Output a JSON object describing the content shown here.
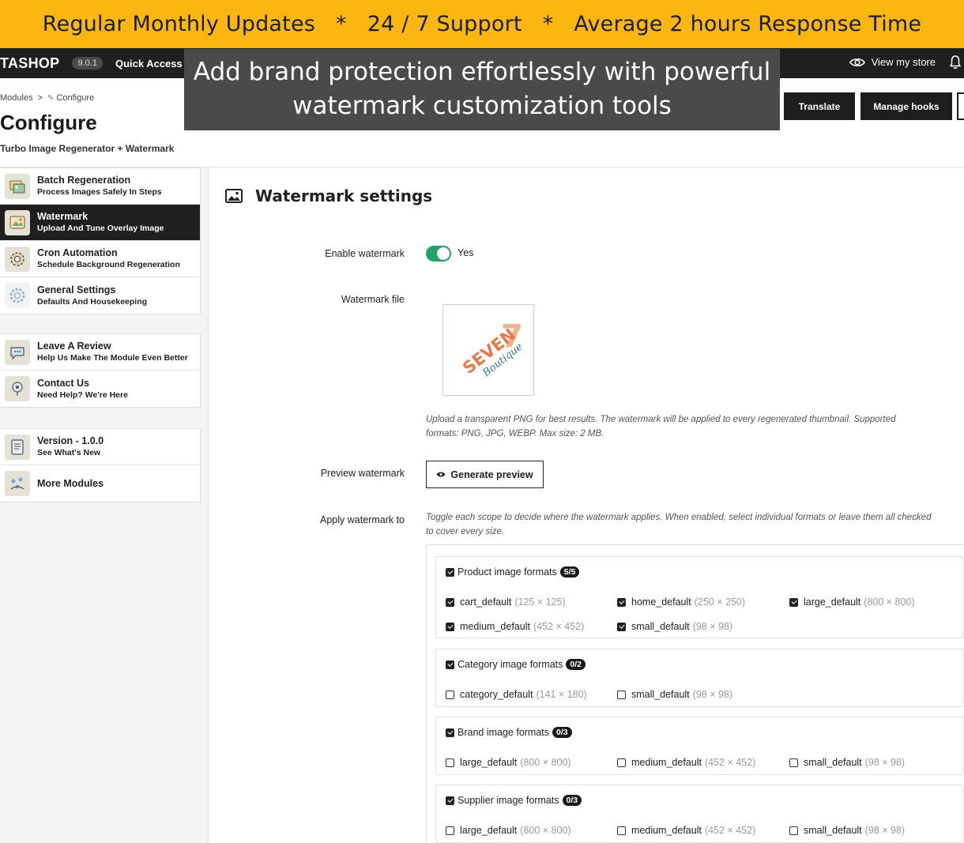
{
  "promo": {
    "items": [
      "Regular Monthly Updates",
      "24 / 7 Support",
      "Average 2 hours Response Time"
    ],
    "separator": "*"
  },
  "topnav": {
    "logo": "TASHOP",
    "version": "9.0.1",
    "quick_access": "Quick Access",
    "view_store": "View my store"
  },
  "overlay": {
    "line1": "Add brand protection effortlessly with powerful",
    "line2": "watermark customization tools"
  },
  "header": {
    "breadcrumb": [
      "Modules",
      "Configure"
    ],
    "breadcrumb_sep": ">",
    "title": "Configure",
    "subtitle": "Turbo Image Regenerator + Watermark",
    "translate": "Translate",
    "manage_hooks": "Manage hooks"
  },
  "sidebar": {
    "groups": [
      [
        {
          "title": "Batch Regeneration",
          "desc": "Process Images Safely In Steps",
          "icon": "images-icon",
          "active": false
        },
        {
          "title": "Watermark",
          "desc": "Upload And Tune Overlay Image",
          "icon": "watermark-icon",
          "active": true
        },
        {
          "title": "Cron Automation",
          "desc": "Schedule Background Regeneration",
          "icon": "cron-gear-icon",
          "active": false
        },
        {
          "title": "General Settings",
          "desc": "Defaults And Housekeeping",
          "icon": "settings-gear-icon",
          "active": false
        }
      ],
      [
        {
          "title": "Leave A Review",
          "desc": "Help Us Make The Module Even Better",
          "icon": "review-bubble-icon",
          "active": false
        },
        {
          "title": "Contact Us",
          "desc": "Need Help? We're Here",
          "icon": "contact-icon",
          "active": false
        }
      ],
      [
        {
          "title": "Version - 1.0.0",
          "desc": "See What's New",
          "icon": "changelog-icon",
          "active": false
        },
        {
          "title": "More Modules",
          "desc": "",
          "icon": "modules-icon",
          "active": false
        }
      ]
    ]
  },
  "main": {
    "section_title": "Watermark settings",
    "enable_label": "Enable watermark",
    "enable_value": "Yes",
    "file_label": "Watermark file",
    "logo_text_1": "SEVEN",
    "logo_text_2": "Boutique",
    "logo_number": "7",
    "file_help_1": "Upload a transparent PNG for best results. The watermark will be applied to every regenerated thumbnail. Supported",
    "file_help_2": "formats: PNG, JPG, WEBP. Max size: 2 MB.",
    "preview_label": "Preview watermark",
    "preview_button": "Generate preview",
    "apply_label": "Apply watermark to",
    "apply_help_1": "Toggle each scope to decide where the watermark applies. When enabled, select individual formats or leave them all checked",
    "apply_help_2": "to cover every size."
  },
  "scopes": [
    {
      "title": "Product image formats",
      "count": "5/5",
      "checked": true,
      "formats": [
        {
          "name": "cart_default",
          "dim": "(125 × 125)",
          "checked": true
        },
        {
          "name": "home_default",
          "dim": "(250 × 250)",
          "checked": true
        },
        {
          "name": "large_default",
          "dim": "(800 × 800)",
          "checked": true
        },
        {
          "name": "medium_default",
          "dim": "(452 × 452)",
          "checked": true
        },
        {
          "name": "small_default",
          "dim": "(98 × 98)",
          "checked": true
        }
      ]
    },
    {
      "title": "Category image formats",
      "count": "0/2",
      "checked": true,
      "formats": [
        {
          "name": "category_default",
          "dim": "(141 × 180)",
          "checked": false
        },
        {
          "name": "small_default",
          "dim": "(98 × 98)",
          "checked": false
        }
      ]
    },
    {
      "title": "Brand image formats",
      "count": "0/3",
      "checked": true,
      "formats": [
        {
          "name": "large_default",
          "dim": "(800 × 800)",
          "checked": false
        },
        {
          "name": "medium_default",
          "dim": "(452 × 452)",
          "checked": false
        },
        {
          "name": "small_default",
          "dim": "(98 × 98)",
          "checked": false
        }
      ]
    },
    {
      "title": "Supplier image formats",
      "count": "0/3",
      "checked": true,
      "formats": [
        {
          "name": "large_default",
          "dim": "(800 × 800)",
          "checked": false
        },
        {
          "name": "medium_default",
          "dim": "(452 × 452)",
          "checked": false
        },
        {
          "name": "small_default",
          "dim": "(98 × 98)",
          "checked": false
        }
      ]
    }
  ],
  "colors": {
    "promo_bg": "#fbb710",
    "nav_bg": "#1f1f1f",
    "toggle_on": "#25a16a",
    "logo_orange": "#e9794a",
    "logo_blue": "#3f6e9c"
  }
}
